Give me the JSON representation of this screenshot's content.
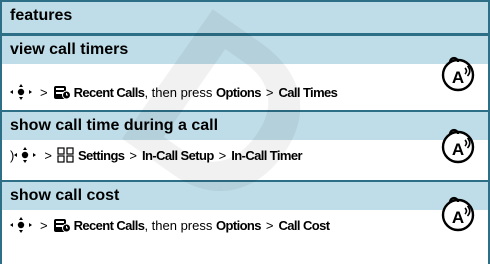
{
  "header": {
    "title": "features"
  },
  "rows": [
    {
      "name": "view call timers",
      "prefix": "",
      "menu1": "Recent Calls",
      "mid": ", then press",
      "menu2": "Options",
      "menu3": "Call Times"
    },
    {
      "name": "show call time during a call",
      "prefix": ")",
      "menu1": "Settings",
      "menu2": "In-Call Setup",
      "menu3": "In-Call Timer"
    },
    {
      "name": "show call cost",
      "prefix": "",
      "menu1": "Recent Calls",
      "mid": ", then press",
      "menu2": "Options",
      "menu3": "Call Cost"
    }
  ],
  "separator": ">",
  "watermark": "D",
  "icons": {
    "nav": "nav-key-icon",
    "recent": "recent-calls-icon",
    "settings": "settings-icon",
    "network": "network-service-icon"
  }
}
